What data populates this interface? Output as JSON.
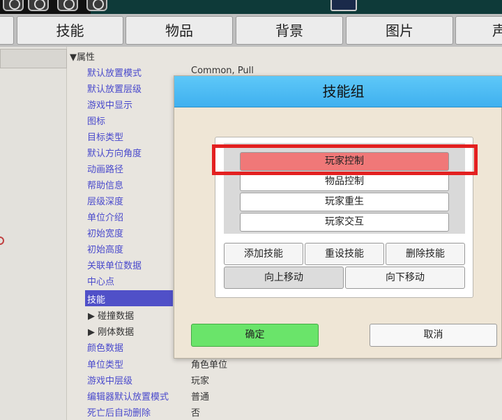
{
  "toolbar": {
    "icons": [
      "document-icon",
      "circle-button-icon",
      "circle-button-icon",
      "lock-icon"
    ]
  },
  "tabs": [
    {
      "label": "技能"
    },
    {
      "label": "物品"
    },
    {
      "label": "背景"
    },
    {
      "label": "图片"
    },
    {
      "label": "声"
    }
  ],
  "properties": {
    "header": "▼属性",
    "rows": [
      {
        "name": "默认放置模式",
        "value": "Common, Pull"
      },
      {
        "name": "默认放置层级",
        "value": ""
      },
      {
        "name": "游戏中显示",
        "value": ""
      },
      {
        "name": "图标",
        "value": ""
      },
      {
        "name": "目标类型",
        "value": ""
      },
      {
        "name": "默认方向角度",
        "value": ""
      },
      {
        "name": "动画路径",
        "value": ""
      },
      {
        "name": "帮助信息",
        "value": ""
      },
      {
        "name": "层级深度",
        "value": ""
      },
      {
        "name": "单位介绍",
        "value": ""
      },
      {
        "name": "初始宽度",
        "value": ""
      },
      {
        "name": "初始高度",
        "value": ""
      },
      {
        "name": "关联单位数据",
        "value": ""
      },
      {
        "name": "中心点",
        "value": ""
      },
      {
        "name": "技能",
        "value": ""
      },
      {
        "name": "▶ 碰撞数据",
        "value": ""
      },
      {
        "name": "▶ 刚体数据",
        "value": ""
      },
      {
        "name": "颜色数据",
        "value": ""
      },
      {
        "name": "单位类型",
        "value": "角色单位"
      },
      {
        "name": "游戏中层级",
        "value": "玩家"
      },
      {
        "name": "编辑器默认放置模式",
        "value": "普通"
      },
      {
        "name": "死亡后自动删除",
        "value": "否"
      }
    ]
  },
  "dialog": {
    "title": "技能组",
    "skills": [
      "玩家控制",
      "物品控制",
      "玩家重生",
      "玩家交互"
    ],
    "selected_skill": "玩家控制",
    "buttons": {
      "add": "添加技能",
      "reset": "重设技能",
      "delete": "删除技能",
      "move_up": "向上移动",
      "move_down": "向下移动",
      "ok": "确定",
      "cancel": "取消"
    }
  },
  "colors": {
    "dialog_title_bar": "#4dbcf3",
    "selected_skill": "#f07878",
    "ok_button": "#6ae46a",
    "highlight": "#e32020",
    "property_name": "#4a4acc",
    "selected_row": "#5050c8"
  }
}
